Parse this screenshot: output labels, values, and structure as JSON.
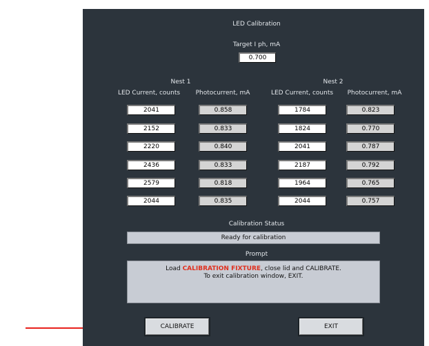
{
  "window": {
    "title": "LED Calibration"
  },
  "target": {
    "label": "Target I ph, mA",
    "value": "0.700"
  },
  "nest1": {
    "title": "Nest 1",
    "led_header": "LED Current, counts",
    "photo_header": "Photocurrent, mA",
    "rows": [
      {
        "led": "2041",
        "photo": "0.858"
      },
      {
        "led": "2152",
        "photo": "0.833"
      },
      {
        "led": "2220",
        "photo": "0.840"
      },
      {
        "led": "2436",
        "photo": "0.833"
      },
      {
        "led": "2579",
        "photo": "0.818"
      },
      {
        "led": "2044",
        "photo": "0.835"
      }
    ]
  },
  "nest2": {
    "title": "Nest 2",
    "led_header": "LED Current, counts",
    "photo_header": "Photocurrent, mA",
    "rows": [
      {
        "led": "1784",
        "photo": "0.823"
      },
      {
        "led": "1824",
        "photo": "0.770"
      },
      {
        "led": "2041",
        "photo": "0.787"
      },
      {
        "led": "2187",
        "photo": "0.792"
      },
      {
        "led": "1964",
        "photo": "0.765"
      },
      {
        "led": "2044",
        "photo": "0.757"
      }
    ]
  },
  "status": {
    "label": "Calibration Status",
    "value": "Ready for calibration"
  },
  "prompt": {
    "label": "Prompt",
    "line1_pre": "Load ",
    "line1_highlight": "CALIBRATION FIXTURE",
    "line1_post": ", close lid and CALIBRATE.",
    "line2": "To exit calibration window, EXIT."
  },
  "buttons": {
    "calibrate": "CALIBRATE",
    "exit": "EXIT"
  },
  "colors": {
    "panel": "#2c343c",
    "highlight": "#e0301e",
    "arrow": "#e8201a"
  }
}
